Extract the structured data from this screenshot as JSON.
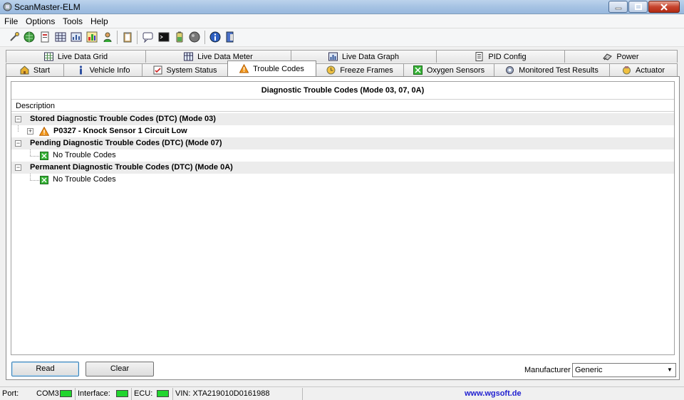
{
  "window": {
    "title": "ScanMaster-ELM"
  },
  "menu": [
    "File",
    "Options",
    "Tools",
    "Help"
  ],
  "tabs_top": [
    {
      "label": "Live Data Grid",
      "icon": "grid-icon"
    },
    {
      "label": "Live Data Meter",
      "icon": "meter-icon"
    },
    {
      "label": "Live Data Graph",
      "icon": "graph-icon"
    },
    {
      "label": "PID Config",
      "icon": "config-icon"
    },
    {
      "label": "Power",
      "icon": "power-icon"
    }
  ],
  "tabs_bottom": [
    {
      "label": "Start",
      "icon": "start-icon"
    },
    {
      "label": "Vehicle Info",
      "icon": "info-icon"
    },
    {
      "label": "System Status",
      "icon": "status-icon"
    },
    {
      "label": "Trouble Codes",
      "icon": "warning-icon",
      "active": true
    },
    {
      "label": "Freeze Frames",
      "icon": "freeze-icon"
    },
    {
      "label": "Oxygen Sensors",
      "icon": "oxygen-icon"
    },
    {
      "label": "Monitored Test Results",
      "icon": "gear-icon"
    },
    {
      "label": "Actuator",
      "icon": "actuator-icon"
    }
  ],
  "panel": {
    "title": "Diagnostic Trouble Codes (Mode 03, 07, 0A)",
    "column_header": "Description",
    "groups": [
      {
        "label": "Stored Diagnostic Trouble Codes (DTC) (Mode 03)",
        "items": [
          {
            "text": "P0327 - Knock Sensor 1 Circuit Low",
            "type": "dtc"
          }
        ]
      },
      {
        "label": "Pending Diagnostic Trouble Codes (DTC) (Mode 07)",
        "items": [
          {
            "text": "No Trouble Codes",
            "type": "ok"
          }
        ]
      },
      {
        "label": "Permanent Diagnostic Trouble Codes (DTC) (Mode 0A)",
        "items": [
          {
            "text": "No Trouble Codes",
            "type": "ok"
          }
        ]
      }
    ]
  },
  "buttons": {
    "read": "Read",
    "clear": "Clear"
  },
  "manufacturer": {
    "label": "Manufacturer",
    "value": "Generic"
  },
  "status": {
    "port_label": "Port:",
    "port_value": "COM3",
    "interface_label": "Interface:",
    "ecu_label": "ECU:",
    "vin": "VIN: XTA219010D0161988",
    "website": "www.wgsoft.de",
    "led_color": "#21d52e"
  }
}
